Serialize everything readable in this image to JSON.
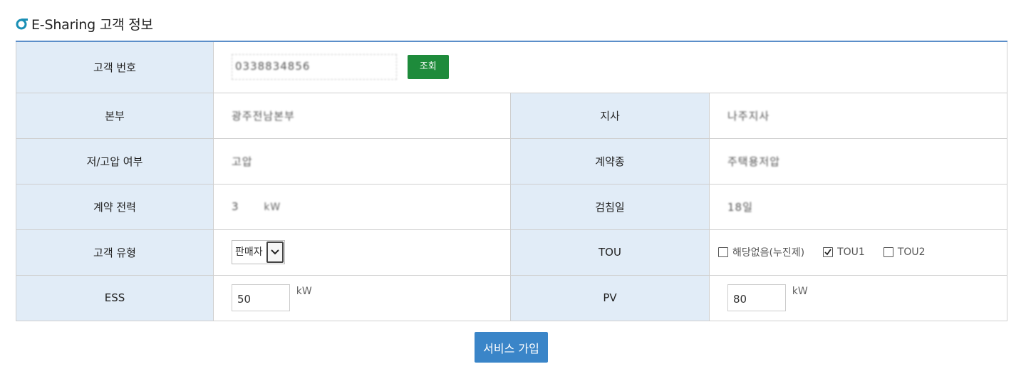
{
  "header": {
    "title": "E-Sharing 고객 정보",
    "icon": "logo-icon"
  },
  "customer_no": {
    "label": "고객 번호",
    "value": "0338834856",
    "search_button": "조회"
  },
  "branch_hq": {
    "label": "본부",
    "value": "광주전남본부"
  },
  "branch": {
    "label": "지사",
    "value": "나주지사"
  },
  "voltage": {
    "label": "저/고압 여부",
    "value": "고압"
  },
  "contract_type": {
    "label": "계약종",
    "value": "주택용저압"
  },
  "contract_power": {
    "label": "계약 전력",
    "value": "3",
    "unit": "kW"
  },
  "meter_day": {
    "label": "검침일",
    "value": "18일"
  },
  "customer_type": {
    "label": "고객 유형",
    "selected": "판매자"
  },
  "tou": {
    "label": "TOU",
    "options": [
      {
        "label": "해당없음(누진제)",
        "checked": false
      },
      {
        "label": "TOU1",
        "checked": true
      },
      {
        "label": "TOU2",
        "checked": false
      }
    ]
  },
  "ess": {
    "label": "ESS",
    "value": "50",
    "unit": "kW"
  },
  "pv": {
    "label": "PV",
    "value": "80",
    "unit": "kW"
  },
  "submit_button": "서비스 가입",
  "colors": {
    "header_cell": "#e1ecf7",
    "accent_top": "#5b8ec9",
    "search_btn": "#1e8b3b",
    "submit_btn": "#3a85c8",
    "logo": "#1a8fb5"
  }
}
